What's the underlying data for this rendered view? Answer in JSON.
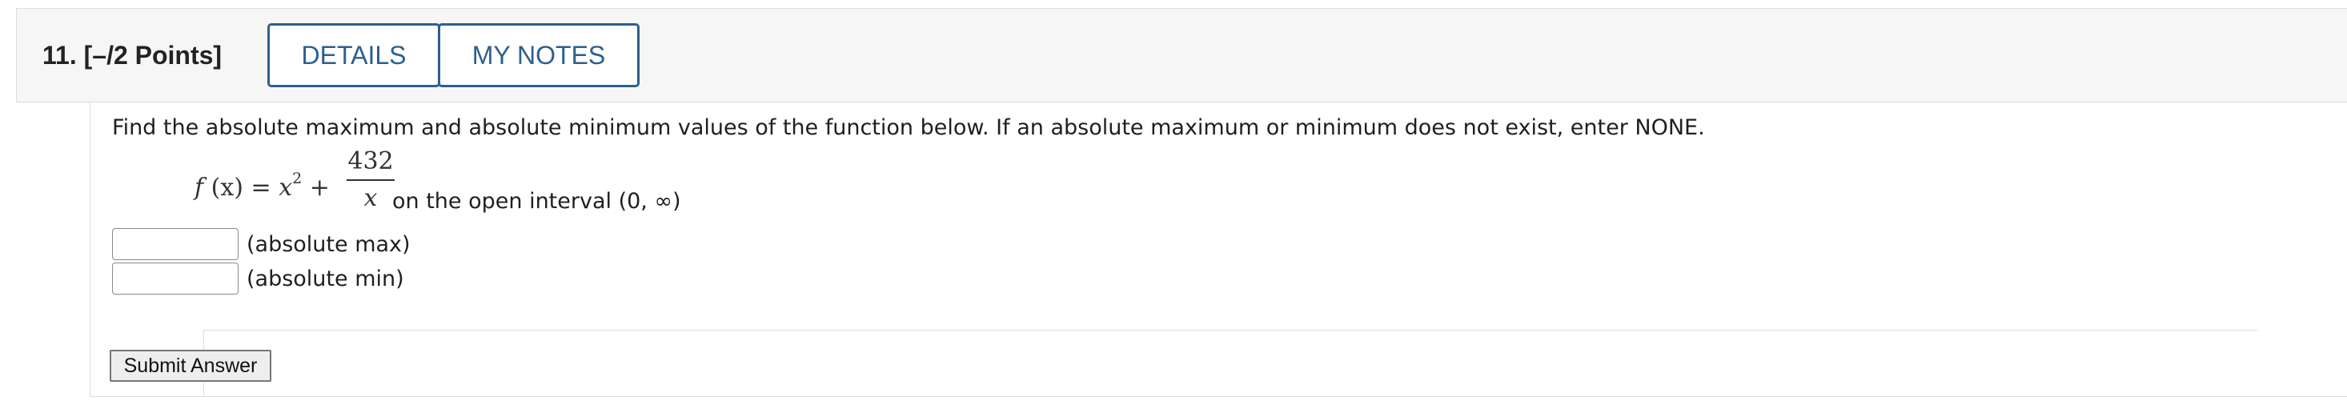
{
  "question": {
    "number_points": "11.  [–/2 Points]",
    "details_label": "DETAILS",
    "notes_label": "MY NOTES",
    "prompt": "Find the absolute maximum and absolute minimum values of the function below. If an absolute maximum or minimum does not exist, enter NONE.",
    "function": {
      "lhs_f": "f",
      "lhs_arg": "(x)",
      "lhs_eq": " = ",
      "lhs_x": "x",
      "lhs_exp": "2",
      "lhs_plus": " + ",
      "numerator": "432",
      "denominator": "x"
    },
    "interval_text": "on the open interval (0, ∞)",
    "answers": [
      {
        "value": "",
        "label": "(absolute max)"
      },
      {
        "value": "",
        "label": "(absolute min)"
      }
    ],
    "submit_label": "Submit Answer"
  }
}
